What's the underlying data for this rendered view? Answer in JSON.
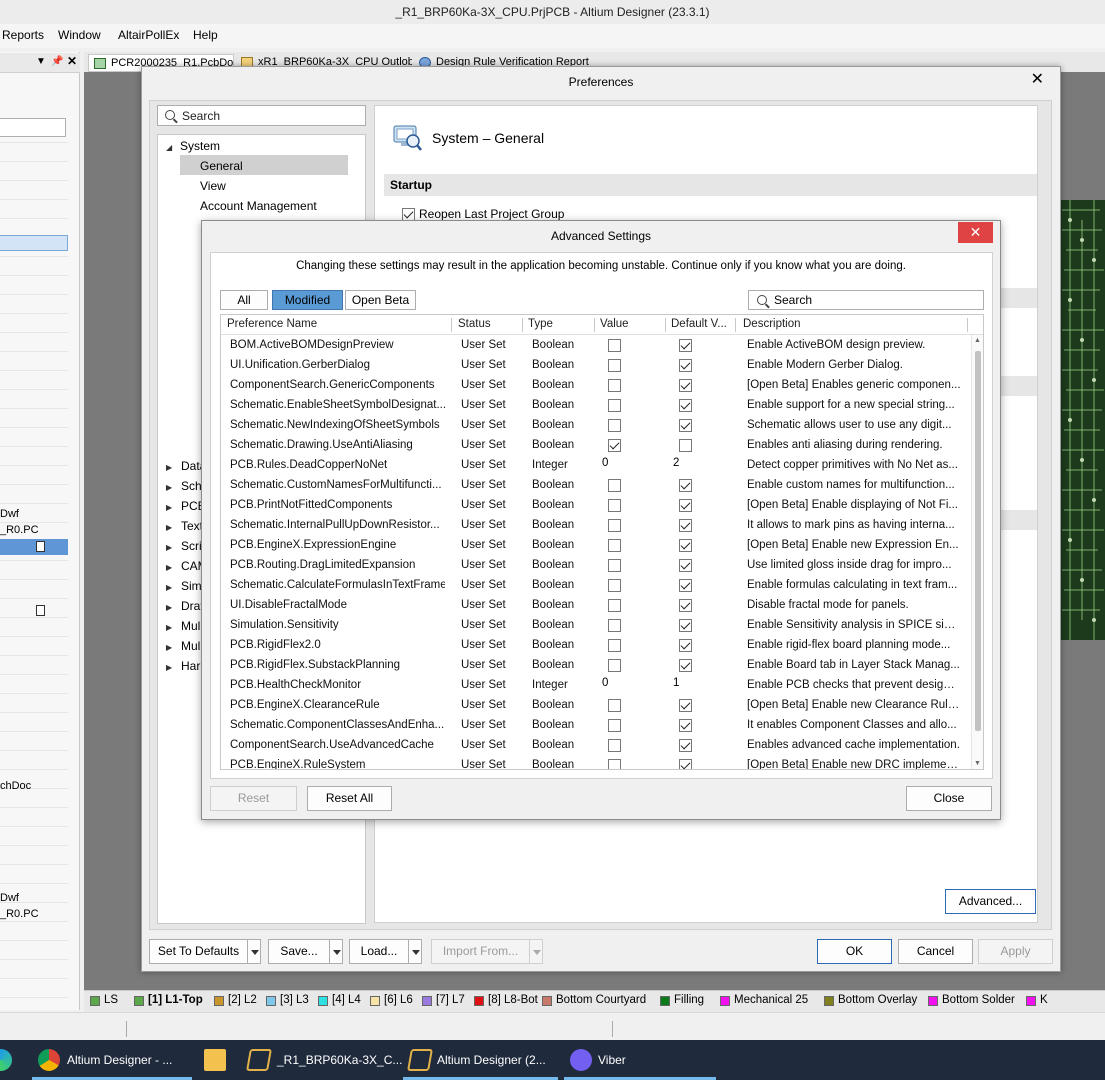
{
  "window": {
    "title": "_R1_BRP60Ka-3X_CPU.PrjPCB - Altium Designer (23.3.1)"
  },
  "menu": {
    "items": [
      "Reports",
      "Window",
      "AltairPollEx",
      "Help"
    ]
  },
  "left_panel": {
    "rows": [
      "Dwf",
      "_R0.PC",
      "chDoc",
      "Dwf",
      "_R0.PC"
    ]
  },
  "doc_tabs": [
    "PCR2000235_R1.PcbDoc",
    "xR1_BRP60Ka-3X_CPU Outlob",
    "Design Rule Verification Report"
  ],
  "preferences": {
    "title": "Preferences",
    "search_placeholder": "Search",
    "tree": {
      "root": "System",
      "children": [
        "General",
        "View",
        "Account Management"
      ],
      "collapsed_partial": [
        "Data",
        "Sche",
        "PCB",
        "Text",
        "Scrip",
        "CAM",
        "Simu",
        "Draf",
        "Mul",
        "Mul",
        "Harn"
      ]
    },
    "section_title": "System – General",
    "startup_label": "Startup",
    "reopen_label": "Reopen Last Project Group",
    "reopen_checked": true,
    "advanced_button": "Advanced...",
    "footer": {
      "set_to_defaults": "Set To Defaults",
      "save": "Save...",
      "load": "Load...",
      "import_from": "Import From...",
      "ok": "OK",
      "cancel": "Cancel",
      "apply": "Apply"
    }
  },
  "advanced": {
    "title": "Advanced Settings",
    "close_glyph": "✕",
    "warning": "Changing these settings may result in the application becoming unstable. Continue only if you know what you are doing.",
    "filters": [
      "All",
      "Modified",
      "Open Beta"
    ],
    "active_filter": "Modified",
    "search_placeholder": "Search",
    "columns": [
      "Preference Name",
      "Status",
      "Type",
      "Value",
      "Default V...",
      "Description"
    ],
    "rows": [
      {
        "name": "BOM.ActiveBOMDesignPreview",
        "status": "User Set",
        "type": "Boolean",
        "value": false,
        "default": true,
        "desc": "Enable ActiveBOM design preview."
      },
      {
        "name": "UI.Unification.GerberDialog",
        "status": "User Set",
        "type": "Boolean",
        "value": false,
        "default": true,
        "desc": "Enable Modern Gerber Dialog."
      },
      {
        "name": "ComponentSearch.GenericComponents",
        "status": "User Set",
        "type": "Boolean",
        "value": false,
        "default": true,
        "desc": "[Open Beta] Enables generic componen..."
      },
      {
        "name": "Schematic.EnableSheetSymbolDesignat...",
        "status": "User Set",
        "type": "Boolean",
        "value": false,
        "default": true,
        "desc": "Enable support for a new special string..."
      },
      {
        "name": "Schematic.NewIndexingOfSheetSymbols",
        "status": "User Set",
        "type": "Boolean",
        "value": false,
        "default": true,
        "desc": "Schematic allows user to use any digit..."
      },
      {
        "name": "Schematic.Drawing.UseAntiAliasing",
        "status": "User Set",
        "type": "Boolean",
        "value": true,
        "default": false,
        "desc": "Enables anti aliasing during rendering."
      },
      {
        "name": "PCB.Rules.DeadCopperNoNet",
        "status": "User Set",
        "type": "Integer",
        "value": "0",
        "default": "2",
        "desc": "Detect copper primitives with No Net as..."
      },
      {
        "name": "Schematic.CustomNamesForMultifuncti...",
        "status": "User Set",
        "type": "Boolean",
        "value": false,
        "default": true,
        "desc": "Enable custom names for multifunction..."
      },
      {
        "name": "PCB.PrintNotFittedComponents",
        "status": "User Set",
        "type": "Boolean",
        "value": false,
        "default": true,
        "desc": "[Open Beta] Enable displaying of Not Fi..."
      },
      {
        "name": "Schematic.InternalPullUpDownResistor...",
        "status": "User Set",
        "type": "Boolean",
        "value": false,
        "default": true,
        "desc": "It allows to mark pins as having interna..."
      },
      {
        "name": "PCB.EngineX.ExpressionEngine",
        "status": "User Set",
        "type": "Boolean",
        "value": false,
        "default": true,
        "desc": "[Open Beta] Enable new Expression En..."
      },
      {
        "name": "PCB.Routing.DragLimitedExpansion",
        "status": "User Set",
        "type": "Boolean",
        "value": false,
        "default": true,
        "desc": "Use limited gloss inside drag for impro..."
      },
      {
        "name": "Schematic.CalculateFormulasInTextFrame",
        "status": "User Set",
        "type": "Boolean",
        "value": false,
        "default": true,
        "desc": "Enable formulas calculating in text fram..."
      },
      {
        "name": "UI.DisableFractalMode",
        "status": "User Set",
        "type": "Boolean",
        "value": false,
        "default": true,
        "desc": "Disable fractal mode for panels."
      },
      {
        "name": "Simulation.Sensitivity",
        "status": "User Set",
        "type": "Boolean",
        "value": false,
        "default": true,
        "desc": "Enable Sensitivity analysis in SPICE simu..."
      },
      {
        "name": "PCB.RigidFlex2.0",
        "status": "User Set",
        "type": "Boolean",
        "value": false,
        "default": true,
        "desc": "Enable rigid-flex board planning mode..."
      },
      {
        "name": "PCB.RigidFlex.SubstackPlanning",
        "status": "User Set",
        "type": "Boolean",
        "value": false,
        "default": true,
        "desc": "Enable Board tab in Layer Stack Manag..."
      },
      {
        "name": "PCB.HealthCheckMonitor",
        "status": "User Set",
        "type": "Integer",
        "value": "0",
        "default": "1",
        "desc": "Enable PCB checks that prevent designs..."
      },
      {
        "name": "PCB.EngineX.ClearanceRule",
        "status": "User Set",
        "type": "Boolean",
        "value": false,
        "default": true,
        "desc": "[Open Beta] Enable new Clearance Rule..."
      },
      {
        "name": "Schematic.ComponentClassesAndEnha...",
        "status": "User Set",
        "type": "Boolean",
        "value": false,
        "default": true,
        "desc": "It enables Component Classes and allo..."
      },
      {
        "name": "ComponentSearch.UseAdvancedCache",
        "status": "User Set",
        "type": "Boolean",
        "value": false,
        "default": true,
        "desc": "Enables advanced cache implementation."
      },
      {
        "name": "PCB.EngineX.RuleSystem",
        "status": "User Set",
        "type": "Boolean",
        "value": false,
        "default": true,
        "desc": "[Open Beta] Enable new DRC implemen..."
      }
    ],
    "reset_label": "Reset",
    "reset_all_label": "Reset All",
    "close_label": "Close"
  },
  "layers": [
    {
      "label": "LS",
      "color": "#5aa84a"
    },
    {
      "label": "[1] L1-Top",
      "color": "#5aa84a",
      "active": true
    },
    {
      "label": "[2] L2",
      "color": "#c8962c"
    },
    {
      "label": "[3] L3",
      "color": "#7fc8ec"
    },
    {
      "label": "[4] L4",
      "color": "#30e0e0"
    },
    {
      "label": "[6] L6",
      "color": "#f7e3a3"
    },
    {
      "label": "[7] L7",
      "color": "#9a7ae0"
    },
    {
      "label": "[8] L8-Bot",
      "color": "#e01010"
    },
    {
      "label": "Bottom Courtyard",
      "color": "#c87a6a"
    },
    {
      "label": "Filling",
      "color": "#0a7a1a"
    },
    {
      "label": "Mechanical 25",
      "color": "#f010f0"
    },
    {
      "label": "Bottom Overlay",
      "color": "#808020"
    },
    {
      "label": "Bottom Solder",
      "color": "#f010f0"
    },
    {
      "label": "K",
      "color": "#f010f0"
    }
  ],
  "taskbar": {
    "items": [
      "Altium Designer - ...",
      "_R1_BRP60Ka-3X_C...",
      "Altium Designer (2...",
      "Viber"
    ]
  }
}
